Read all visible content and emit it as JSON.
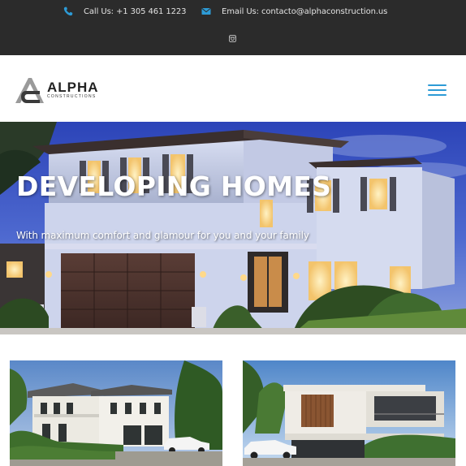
{
  "topbar": {
    "phone": {
      "icon": "phone-icon",
      "text": "Call Us: +1 305 461 1223"
    },
    "email": {
      "icon": "envelope-icon",
      "text": "Email Us: contacto@alphaconstruction.us"
    },
    "social": {
      "icon": "instagram-icon"
    },
    "colors": {
      "background": "#2b2b2b",
      "icon_accent": "#2d9bd6"
    }
  },
  "header": {
    "logo": {
      "name": "ALPHA",
      "subtitle": "CONSTRUCTIONS",
      "icon": "alpha-logo-icon"
    },
    "menu": {
      "icon": "hamburger-menu-icon",
      "color": "#2d9bd6"
    }
  },
  "hero": {
    "title": "DEVELOPING HOMES",
    "subtitle": "With maximum comfort and glamour for you and your family"
  },
  "projects": [
    {
      "image": "colonial-house-rendering"
    },
    {
      "image": "modern-house-rendering"
    }
  ]
}
